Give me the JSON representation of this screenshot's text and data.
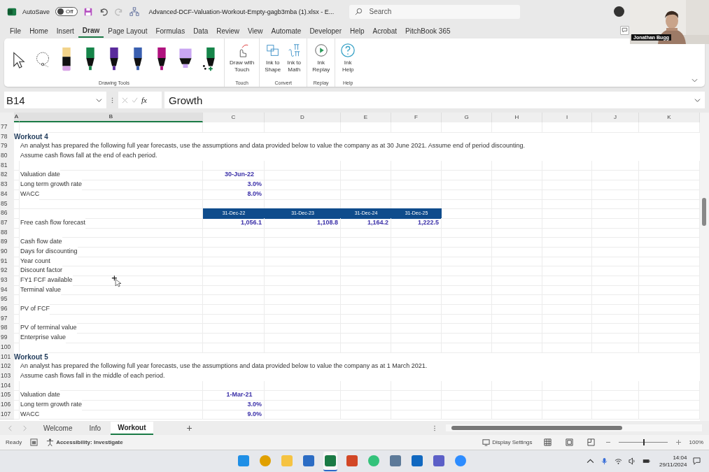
{
  "title_bar": {
    "autosave_label": "AutoSave",
    "autosave": {
      "on": false,
      "text": "Off"
    },
    "filename": "Advanced-DCF-Valuation-Workout-Empty-gagb3mba (1).xlsx  -  E...",
    "search": {
      "placeholder": "Search"
    }
  },
  "video": {
    "kind": "picture",
    "name": "Jonathan Bugg"
  },
  "menu_tabs": [
    {
      "label": "File",
      "selected": false
    },
    {
      "label": "Home",
      "selected": false
    },
    {
      "label": "Insert",
      "selected": false
    },
    {
      "label": "Draw",
      "selected": true
    },
    {
      "label": "Page Layout",
      "selected": false
    },
    {
      "label": "Formulas",
      "selected": false
    },
    {
      "label": "Data",
      "selected": false
    },
    {
      "label": "Review",
      "selected": false
    },
    {
      "label": "View",
      "selected": false
    },
    {
      "label": "Automate",
      "selected": false
    },
    {
      "label": "Developer",
      "selected": false
    },
    {
      "label": "Help",
      "selected": false
    },
    {
      "label": "Acrobat",
      "selected": false
    },
    {
      "label": "PitchBook 365",
      "selected": false
    }
  ],
  "ribbon": {
    "tools": [
      {
        "kind": "select"
      },
      {
        "kind": "lasso"
      },
      {
        "kind": "pencil",
        "color": "#f2d38a"
      },
      {
        "kind": "pen",
        "color": "#16854a"
      },
      {
        "kind": "pen",
        "color": "#5a2a9c"
      },
      {
        "kind": "pen",
        "color": "#3a5fb0"
      },
      {
        "kind": "pen",
        "color": "#b0127e"
      },
      {
        "kind": "highlighter",
        "color": "#c9a6f2"
      },
      {
        "kind": "action",
        "color": "#16854a"
      }
    ],
    "tools_label": "Drawing Tools",
    "groups": [
      {
        "label": "Touch",
        "buttons": [
          {
            "kind": "touch",
            "label": "Draw with\nTouch"
          }
        ]
      },
      {
        "label": "Convert",
        "buttons": [
          {
            "kind": "shape",
            "label": "Ink to\nShape"
          },
          {
            "kind": "math",
            "label": "Ink to\nMath"
          }
        ]
      },
      {
        "label": "Replay",
        "buttons": [
          {
            "kind": "replay",
            "label": "Ink\nReplay"
          }
        ]
      },
      {
        "label": "Help",
        "buttons": [
          {
            "kind": "help",
            "label": "Ink\nHelp"
          }
        ]
      }
    ]
  },
  "formula_bar": {
    "name_box": "B14",
    "fx": "fx",
    "value": "Growth"
  },
  "columns": [
    {
      "label": "A",
      "selected": true
    },
    {
      "label": "B",
      "selected": true
    },
    {
      "label": "C",
      "selected": false
    },
    {
      "label": "D",
      "selected": false
    },
    {
      "label": "E",
      "selected": false
    },
    {
      "label": "F",
      "selected": false
    },
    {
      "label": "G",
      "selected": false
    },
    {
      "label": "H",
      "selected": false
    },
    {
      "label": "I",
      "selected": false
    },
    {
      "label": "J",
      "selected": false
    },
    {
      "label": "K",
      "selected": false
    }
  ],
  "rows": [
    {
      "n": "77",
      "kind": "blank"
    },
    {
      "n": "78",
      "kind": "heading",
      "text": "Workout 4"
    },
    {
      "n": "79",
      "kind": "note",
      "text": "An analyst has prepared the following full year forecasts, use the assumptions and data provided below to value the company as at 30 June 2021. Assume end of period discounting."
    },
    {
      "n": "80",
      "kind": "note",
      "text": "Assume cash flows fall at the end of each period."
    },
    {
      "n": "81",
      "kind": "blank"
    },
    {
      "n": "82",
      "kind": "label",
      "text": "Valuation date",
      "input": {
        "kind": "date",
        "value": "30-Jun-22"
      }
    },
    {
      "n": "83",
      "kind": "label",
      "text": "Long term growth rate",
      "input": {
        "kind": "number",
        "value": "3.0%"
      }
    },
    {
      "n": "84",
      "kind": "label",
      "text": "WACC",
      "input": {
        "kind": "number",
        "value": "8.0%"
      }
    },
    {
      "n": "85",
      "kind": "blank"
    },
    {
      "n": "86",
      "kind": "band",
      "values": [
        "31-Dec-22",
        "31-Dec-23",
        "31-Dec-24",
        "31-Dec-25"
      ]
    },
    {
      "n": "87",
      "kind": "values",
      "text": "Free cash flow forecast",
      "values": [
        "1,056.1",
        "1,108.8",
        "1,164.2",
        "1,222.5"
      ]
    },
    {
      "n": "88",
      "kind": "blank"
    },
    {
      "n": "89",
      "kind": "label",
      "text": "Cash flow date"
    },
    {
      "n": "90",
      "kind": "label",
      "text": "Days for discounting"
    },
    {
      "n": "91",
      "kind": "label",
      "text": "Year count"
    },
    {
      "n": "92",
      "kind": "label",
      "text": "Discount factor"
    },
    {
      "n": "93",
      "kind": "label",
      "text": "FY1 FCF available"
    },
    {
      "n": "94",
      "kind": "label",
      "text": "Terminal value"
    },
    {
      "n": "95",
      "kind": "blank"
    },
    {
      "n": "96",
      "kind": "label",
      "text": "PV of FCF"
    },
    {
      "n": "97",
      "kind": "blank"
    },
    {
      "n": "98",
      "kind": "label",
      "text": "PV of terminal value"
    },
    {
      "n": "99",
      "kind": "label",
      "text": "Enterprise value"
    },
    {
      "n": "100",
      "kind": "blank"
    },
    {
      "n": "101",
      "kind": "heading",
      "text": "Workout 5"
    },
    {
      "n": "102",
      "kind": "note",
      "text": "An analyst has prepared the following full year forecasts, use the assumptions and data provided below to value the company as at 1 March 2021."
    },
    {
      "n": "103",
      "kind": "note",
      "text": "Assume cash flows fall in the middle of each period."
    },
    {
      "n": "104",
      "kind": "blank"
    },
    {
      "n": "105",
      "kind": "label",
      "text": "Valuation date",
      "input": {
        "kind": "date",
        "value": "1-Mar-21"
      }
    },
    {
      "n": "106",
      "kind": "label",
      "text": "Long term growth rate",
      "input": {
        "kind": "number",
        "value": "3.0%"
      }
    },
    {
      "n": "107",
      "kind": "label",
      "text": "WACC",
      "input": {
        "kind": "number",
        "value": "9.0%"
      }
    }
  ],
  "sheet_tabs": [
    {
      "label": "Welcome",
      "selected": false
    },
    {
      "label": "Info",
      "selected": false
    },
    {
      "label": "Workout",
      "selected": true
    }
  ],
  "add_sheet": "+",
  "status_bar": {
    "mode": "Ready",
    "accessibility": "Accessibility: Investigate",
    "display_settings": "Display Settings",
    "zoom": {
      "level": 0.5,
      "text": "100%"
    }
  },
  "taskbar": {
    "apps": [
      {
        "kind": "start",
        "selected": false
      },
      {
        "kind": "chrome",
        "selected": false
      },
      {
        "kind": "folder",
        "selected": false
      },
      {
        "kind": "word",
        "selected": false
      },
      {
        "kind": "excel",
        "selected": true
      },
      {
        "kind": "powerpoint",
        "selected": false
      },
      {
        "kind": "media",
        "selected": false
      },
      {
        "kind": "calculator",
        "selected": false
      },
      {
        "kind": "outlook",
        "selected": false
      },
      {
        "kind": "teams",
        "selected": false
      },
      {
        "kind": "zoom",
        "selected": false
      }
    ],
    "time": "14:04",
    "date": "29/11/2024"
  }
}
